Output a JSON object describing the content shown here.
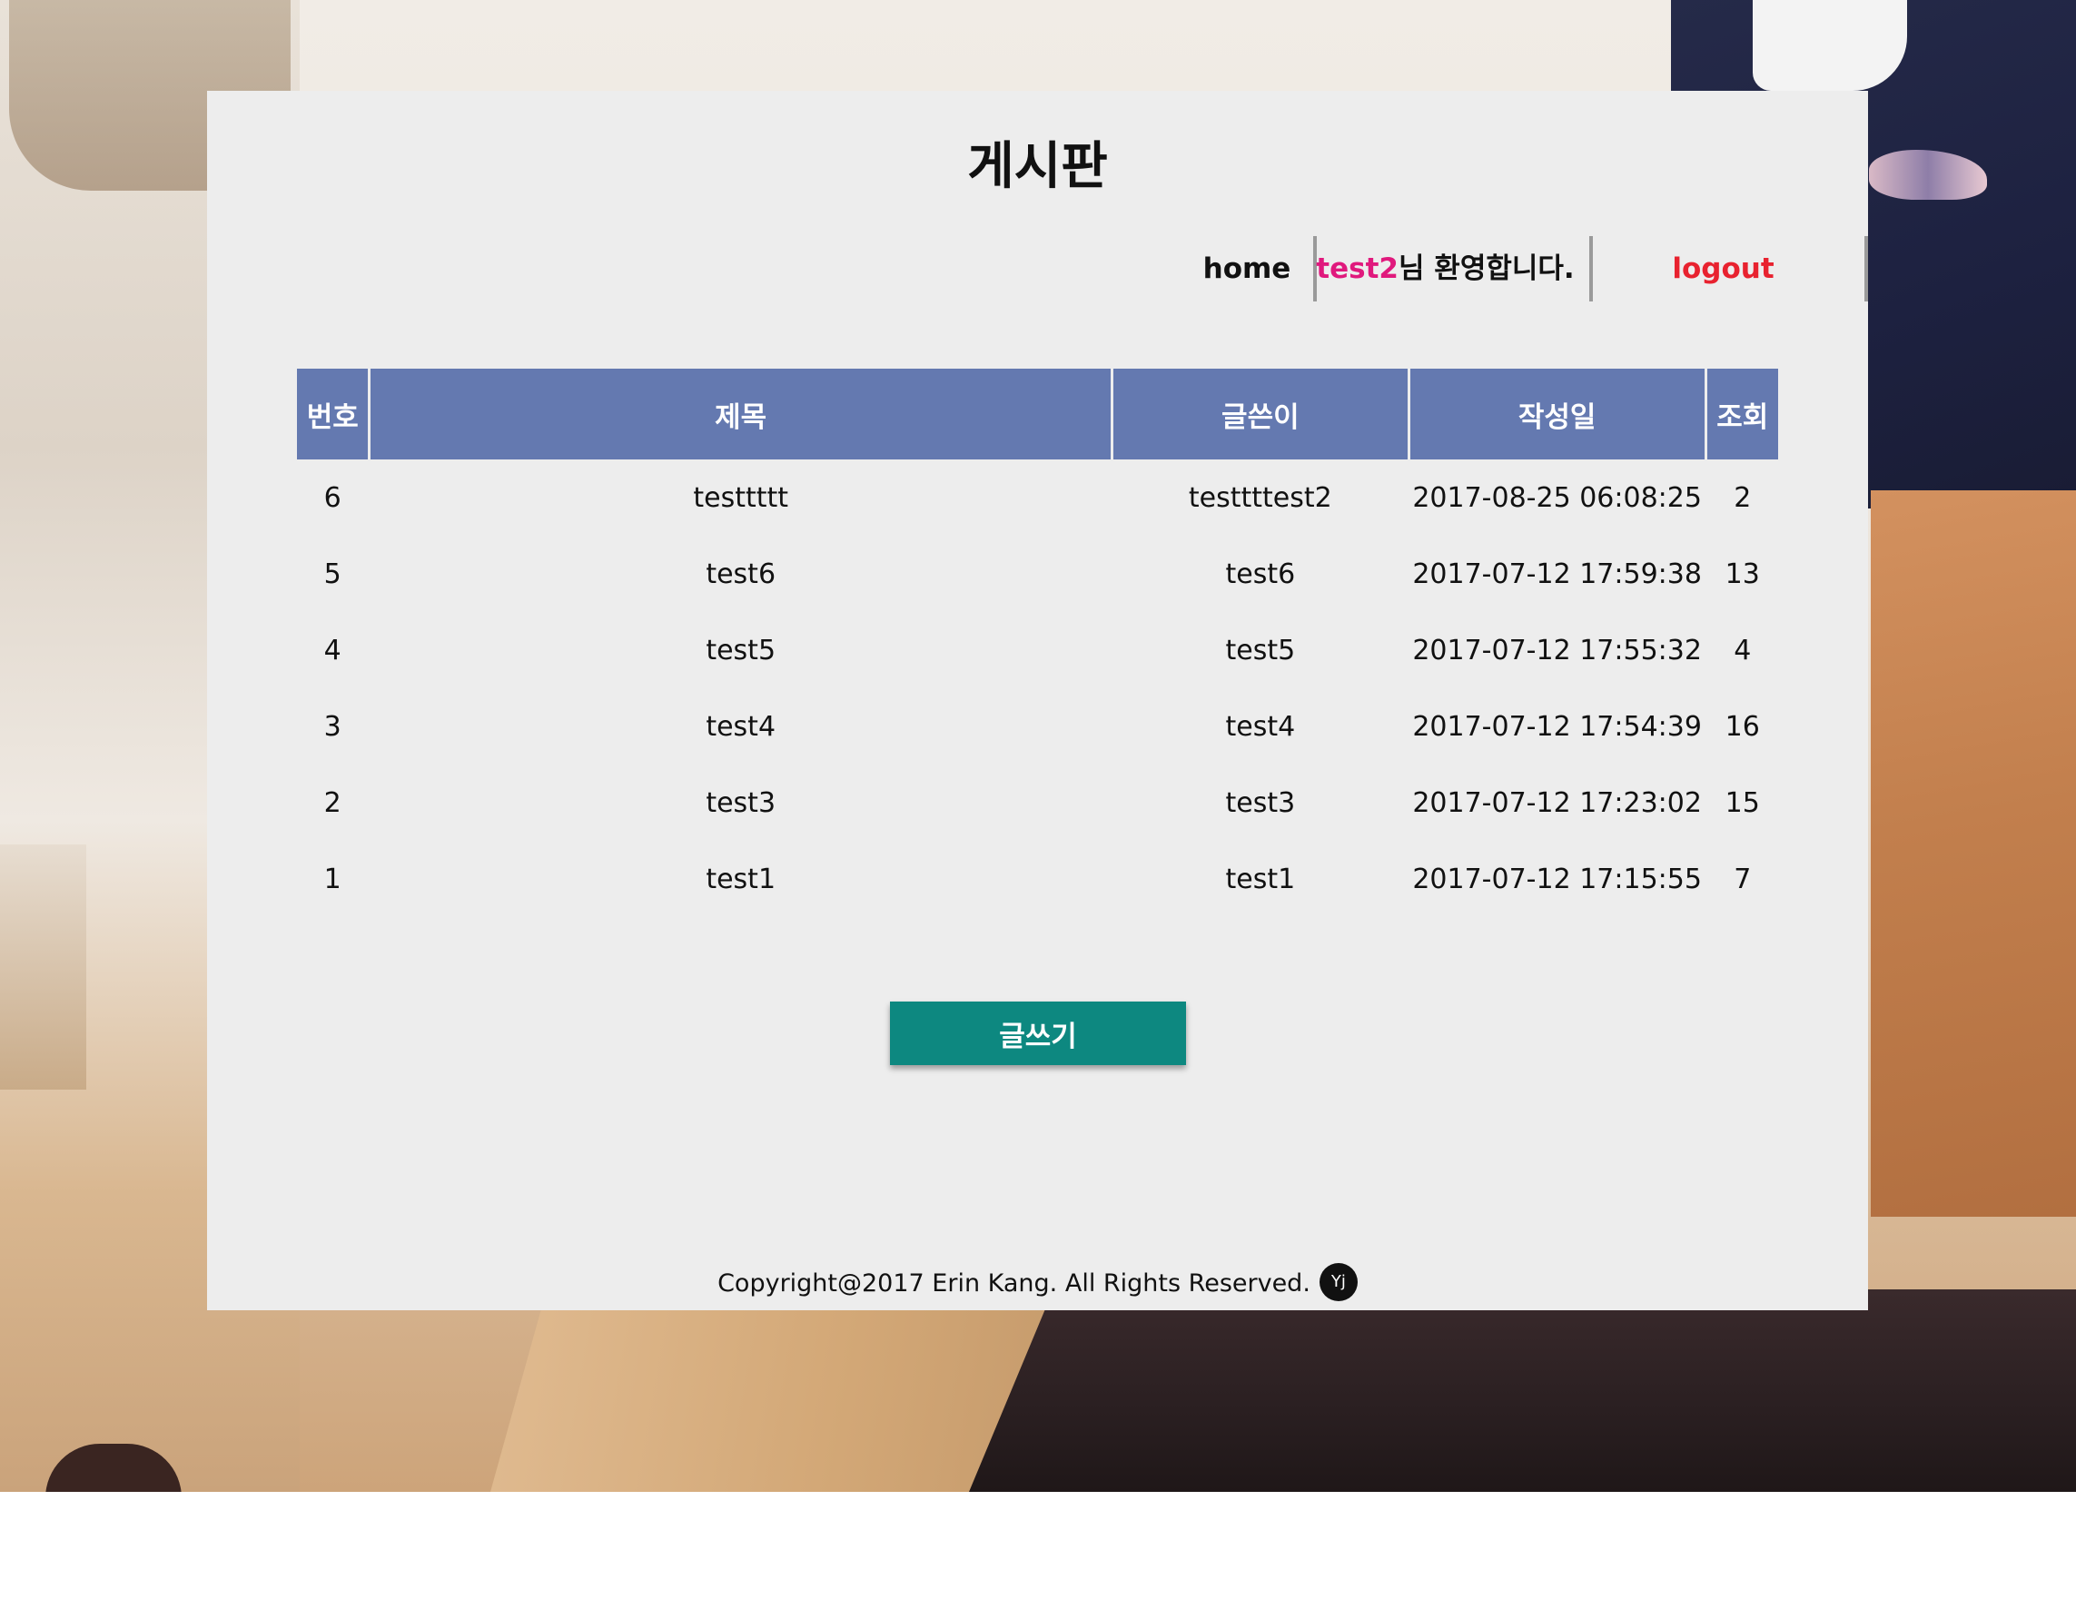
{
  "page": {
    "title": "게시판"
  },
  "nav": {
    "home_label": "home",
    "welcome_user": "test2",
    "welcome_suffix": "님 환영합니다.",
    "logout_label": "logout",
    "colors": {
      "user": "#e0197d",
      "logout": "#e8222f"
    }
  },
  "table": {
    "headers": [
      "번호",
      "제목",
      "글쓴이",
      "작성일",
      "조회"
    ],
    "header_color": "#6479b0",
    "rows": [
      {
        "no": "6",
        "title": "testtttt",
        "writer": "testtttest2",
        "date": "2017-08-25 06:08:25",
        "hits": "2"
      },
      {
        "no": "5",
        "title": "test6",
        "writer": "test6",
        "date": "2017-07-12 17:59:38",
        "hits": "13"
      },
      {
        "no": "4",
        "title": "test5",
        "writer": "test5",
        "date": "2017-07-12 17:55:32",
        "hits": "4"
      },
      {
        "no": "3",
        "title": "test4",
        "writer": "test4",
        "date": "2017-07-12 17:54:39",
        "hits": "16"
      },
      {
        "no": "2",
        "title": "test3",
        "writer": "test3",
        "date": "2017-07-12 17:23:02",
        "hits": "15"
      },
      {
        "no": "1",
        "title": "test1",
        "writer": "test1",
        "date": "2017-07-12 17:15:55",
        "hits": "7"
      }
    ]
  },
  "actions": {
    "write_label": "글쓰기",
    "write_color": "#0d8880"
  },
  "footer": {
    "copyright": "Copyright@2017 Erin Kang. All Rights Reserved.",
    "badge_icon": "yj-logo-icon",
    "badge_text": "Yj"
  }
}
